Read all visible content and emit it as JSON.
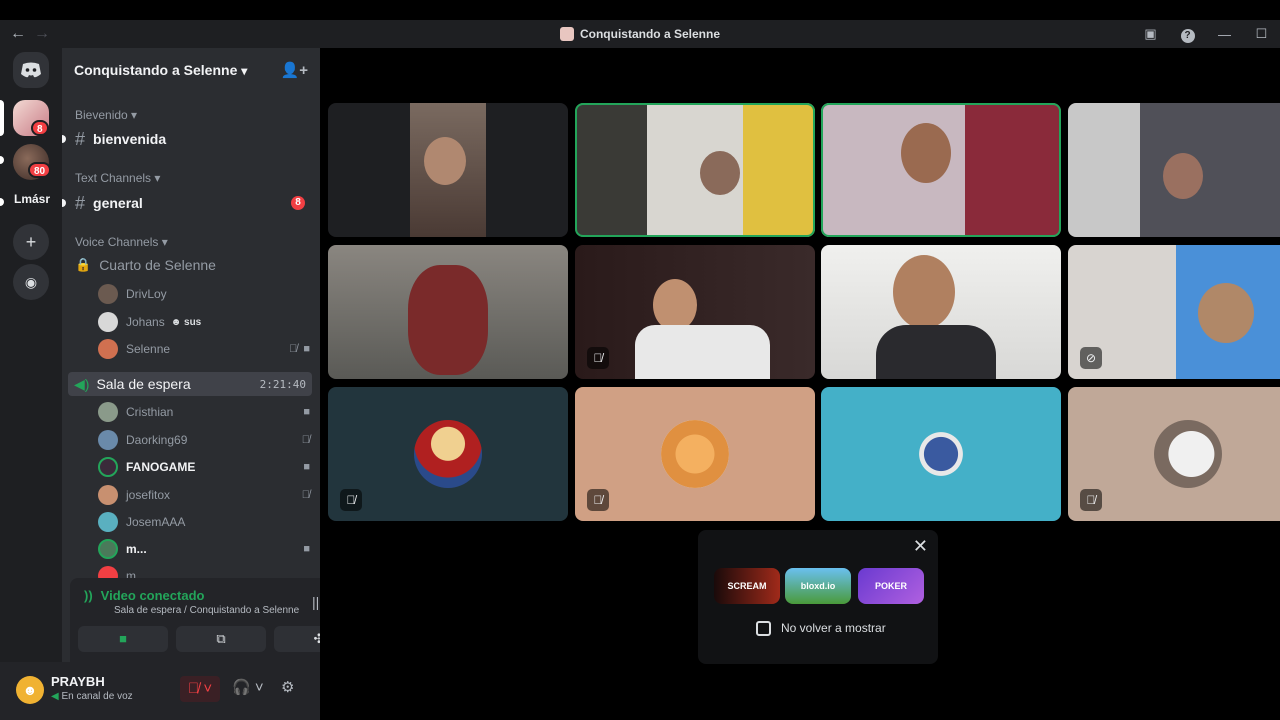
{
  "window": {
    "title": "Conquistando a Selenne",
    "back": "←",
    "forward": "→"
  },
  "rail": {
    "server1_badge": "8",
    "server2_badge": "80",
    "more_label": "Lmásr"
  },
  "server": {
    "name": "Conquistando a Selenne",
    "chevron": "⌄"
  },
  "categories": {
    "welcome": "Bievenido",
    "text": "Text Channels",
    "voice": "Voice Channels"
  },
  "channels": {
    "bienvenida": "bienvenida",
    "general": "general",
    "general_badge": "8",
    "room": "Cuarto de Selenne",
    "waiting": "Sala de espera",
    "waiting_timer": "2:21:40"
  },
  "room_users": [
    {
      "name": "DrivLoy"
    },
    {
      "name": "Johans",
      "tag": "sus"
    },
    {
      "name": "Selenne"
    }
  ],
  "waiting_users": [
    {
      "name": "Cristhian"
    },
    {
      "name": "Daorking69"
    },
    {
      "name": "FANOGAME"
    },
    {
      "name": "josefitox"
    },
    {
      "name": "JosemAAA"
    },
    {
      "name": "m..."
    },
    {
      "name": "m"
    }
  ],
  "voice_panel": {
    "status": "Video conectado",
    "location": "Sala de espera / Conquistando a Selenne"
  },
  "user": {
    "name": "PRAYBH",
    "status": "En canal de voz"
  },
  "popup": {
    "close": "✕",
    "apps": [
      "SCREAM",
      "bloxd.io",
      "POKER"
    ],
    "dont_show": "No volver a mostrar"
  },
  "colors": {
    "green": "#23a55a",
    "red": "#f23f43",
    "sidebar": "#2b2d31",
    "rail": "#1e1f22"
  }
}
